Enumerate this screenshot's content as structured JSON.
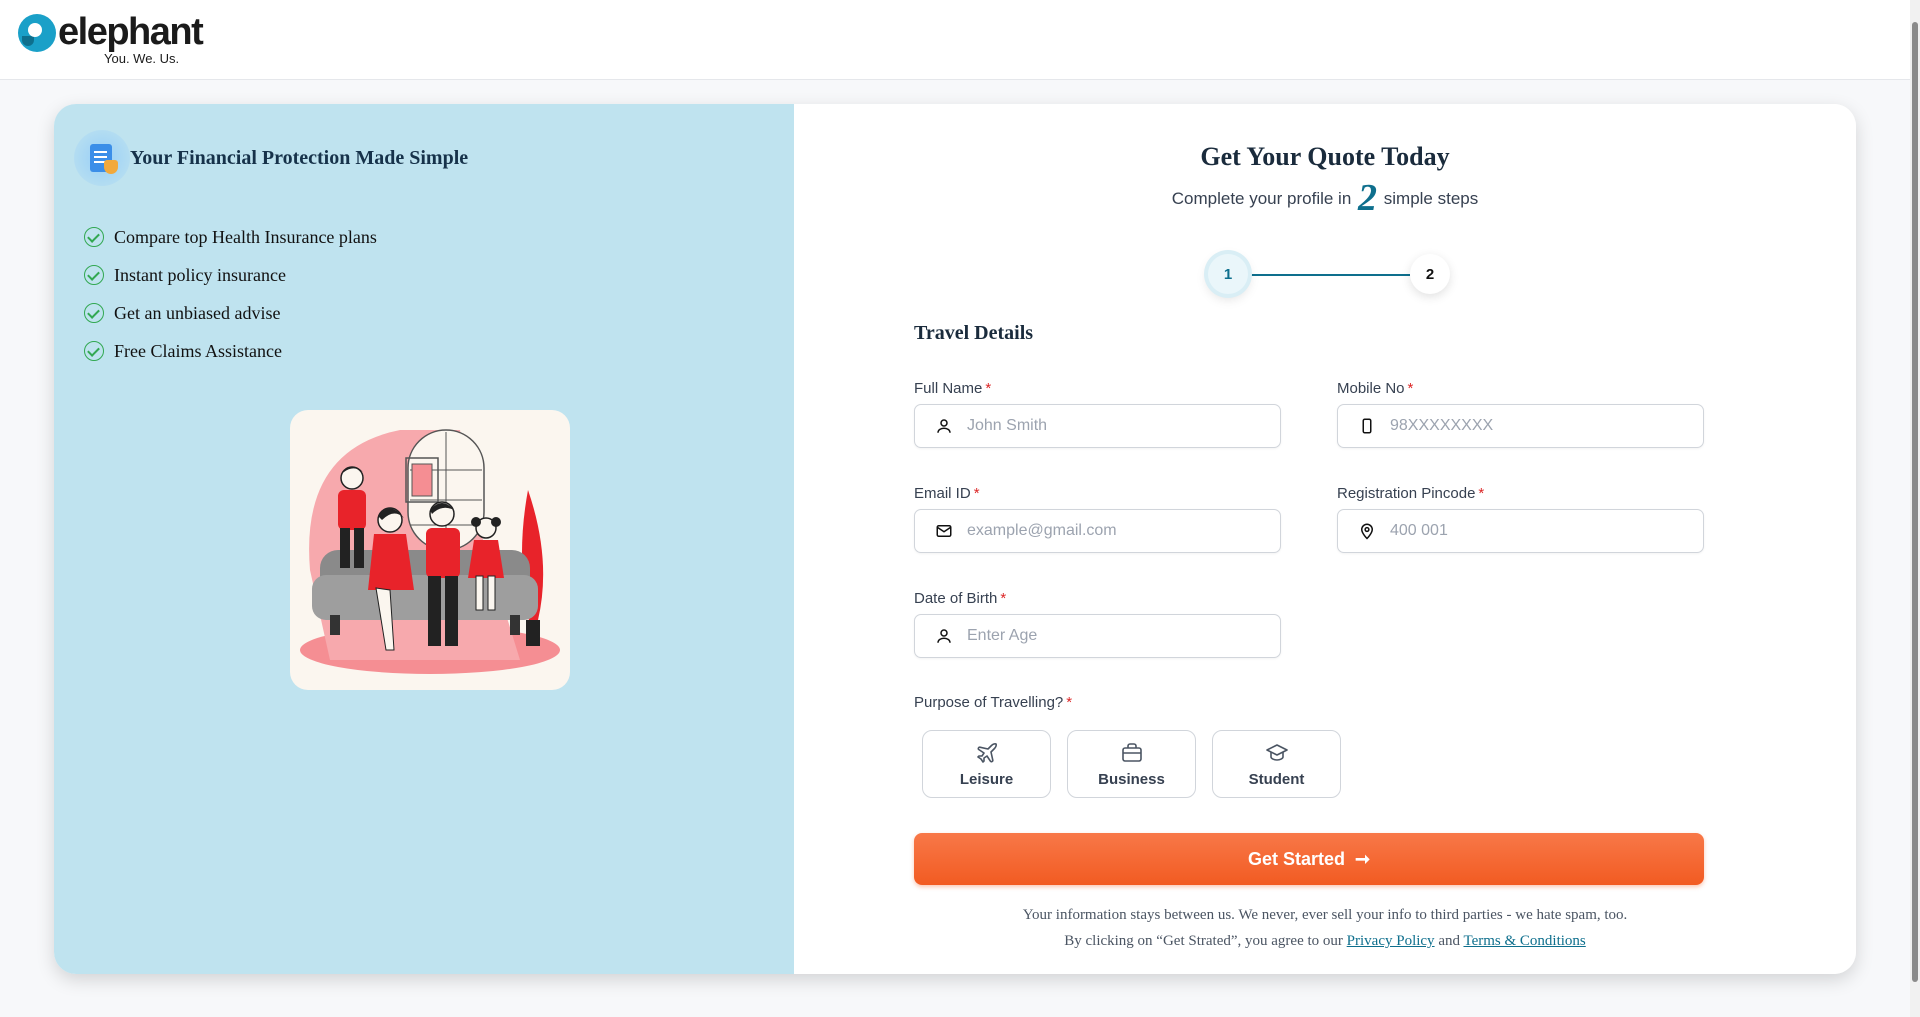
{
  "brand": {
    "name": "elephant",
    "tagline": "You. We. Us."
  },
  "left_panel": {
    "title": "Your Financial Protection Made Simple",
    "features": [
      "Compare top Health Insurance plans",
      "Instant policy insurance",
      "Get an unbiased advise",
      "Free Claims Assistance"
    ]
  },
  "form": {
    "title": "Get Your Quote Today",
    "subtitle_before": "Complete your profile in",
    "subtitle_number": "2",
    "subtitle_after": "simple steps",
    "steps": [
      "1",
      "2"
    ],
    "current_step": 1,
    "section_title": "Travel Details",
    "fields": {
      "full_name": {
        "label": "Full Name",
        "required_mark": "*",
        "placeholder": "John Smith",
        "value": ""
      },
      "mobile": {
        "label": "Mobile No",
        "required_mark": "*",
        "placeholder": "98XXXXXXXX",
        "value": ""
      },
      "email": {
        "label": "Email ID",
        "required_mark": "*",
        "placeholder": "example@gmail.com",
        "value": ""
      },
      "pincode": {
        "label": "Registration Pincode",
        "required_mark": "*",
        "placeholder": "400 001",
        "value": ""
      },
      "dob": {
        "label": "Date of Birth",
        "required_mark": "*",
        "placeholder": "Enter Age",
        "value": ""
      }
    },
    "purpose": {
      "label": "Purpose of Travelling?",
      "required_mark": "*",
      "options": [
        {
          "label": "Leisure",
          "icon": "plane-icon"
        },
        {
          "label": "Business",
          "icon": "briefcase-icon"
        },
        {
          "label": "Student",
          "icon": "graduation-cap-icon"
        }
      ]
    },
    "submit_label": "Get Started",
    "submit_arrow": "➞",
    "disclaimer_line1": "Your information stays between us. We never, ever sell your info to third parties - we hate spam, too.",
    "disclaimer_line2_before": "By clicking on “Get Strated”, you agree to our",
    "privacy_link": "Privacy Policy",
    "and_text": "and",
    "terms_link": "Terms & Conditions"
  },
  "colors": {
    "accent": "#0e6f8d",
    "cta": "#f25b22",
    "left_panel_bg": "#bfe3ef",
    "check": "#32a852",
    "required": "#dc2626"
  }
}
